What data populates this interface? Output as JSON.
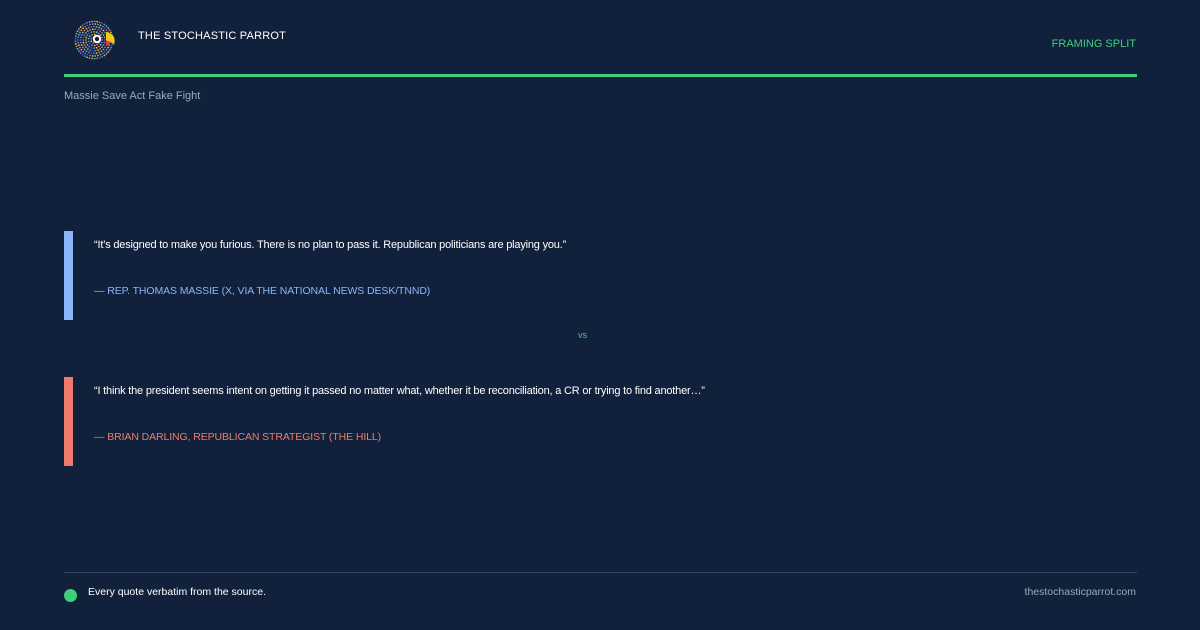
{
  "header": {
    "brand": "THE STOCHASTIC PARROT",
    "tag": "FRAMING SPLIT",
    "subtitle": "Massie Save Act Fake Fight",
    "logo_icon": "parrot-logo-icon"
  },
  "quotes": [
    {
      "text": "“It’s designed to make you furious. There is no plan to pass it. Republican politicians are playing you.”",
      "attribution": "— REP. THOMAS MASSIE (X, VIA THE NATIONAL NEWS DESK/TNND)",
      "color": "#8ab4f8"
    },
    {
      "text": "“I think the president seems intent on getting it passed no matter what, whether it be reconciliation, a CR or trying to find another…”",
      "attribution": "— BRIAN DARLING, REPUBLICAN STRATEGIST (THE HILL)",
      "color": "#f07a6a"
    }
  ],
  "divider": "vs",
  "footer": {
    "note": "Every quote verbatim from the source.",
    "site": "thestochasticparrot.com"
  },
  "colors": {
    "background": "#12213b",
    "accent": "#3ecf7b"
  }
}
